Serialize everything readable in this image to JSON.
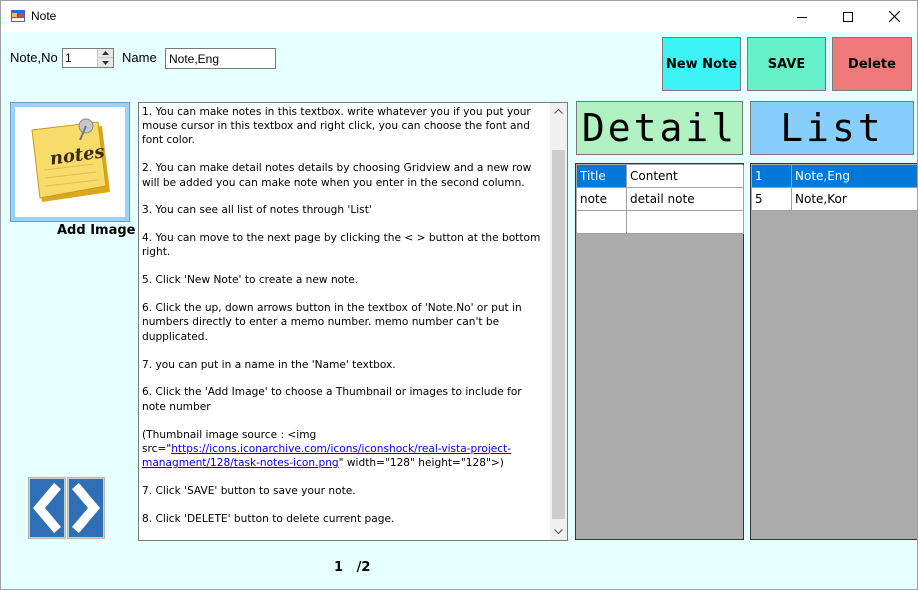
{
  "window": {
    "title": "Note"
  },
  "top_bar": {
    "note_no_label": "Note,No",
    "note_no_value": "1",
    "name_label": "Name",
    "name_value": "Note,Eng"
  },
  "buttons": {
    "new_note": "New Note",
    "save": "SAVE",
    "delete": "Delete"
  },
  "image_panel": {
    "add_image_label": "Add Image",
    "thumbnail_icon": "notes-icon"
  },
  "notes_text": {
    "p1": "1. You can make notes in this textbox. write whatever you if you put your mouse cursor in this textbox and right click, you can choose the font and font color.",
    "p2": "2. You can make detail notes details by choosing Gridview and a new row will be added you can make note when you enter in the second column.",
    "p3": "3. You can see all list of notes through 'List'",
    "p4": "4. You can move to the next page by clicking the < > button at the bottom right.",
    "p5": "5. Click 'New Note' to create a new note.",
    "p6": "6. Click the up, down arrows button in the textbox of 'Note.No' or put in numbers directly to enter a memo number. memo number can't be dupplicated.",
    "p7": "7. you can put in a name in the 'Name' textbox.",
    "p8": "6. Click the 'Add Image' to choose a Thumbnail or images to include for note number",
    "p9_pre": "(Thumbnail image source : <img src=\"",
    "p9_link": "https://icons.iconarchive.com/icons/iconshock/real-vista-project-managment/128/task-notes-icon.png",
    "p9_post": "\" width=\"128\" height=\"128\">)",
    "p10": "7. Click 'SAVE' button to save your note.",
    "p11": "8. Click 'DELETE' button to delete current page."
  },
  "pagination": {
    "current": "1",
    "separator": "/",
    "total": "2"
  },
  "detail": {
    "header": "Detail",
    "rows": [
      {
        "key": "Title",
        "value": "Content"
      },
      {
        "key": "note",
        "value": "detail note"
      },
      {
        "key": "",
        "value": ""
      }
    ]
  },
  "list": {
    "header": "List",
    "rows": [
      {
        "no": "1",
        "name": "Note,Eng"
      },
      {
        "no": "5",
        "name": "Note,Kor"
      }
    ]
  },
  "colors": {
    "background": "#e6ffff",
    "new_note": "#3cf4f4",
    "save": "#66f0c8",
    "delete": "#f07a7a",
    "detail_header": "#b0f2c2",
    "list_header": "#87cefa",
    "selection": "#0078d7"
  }
}
